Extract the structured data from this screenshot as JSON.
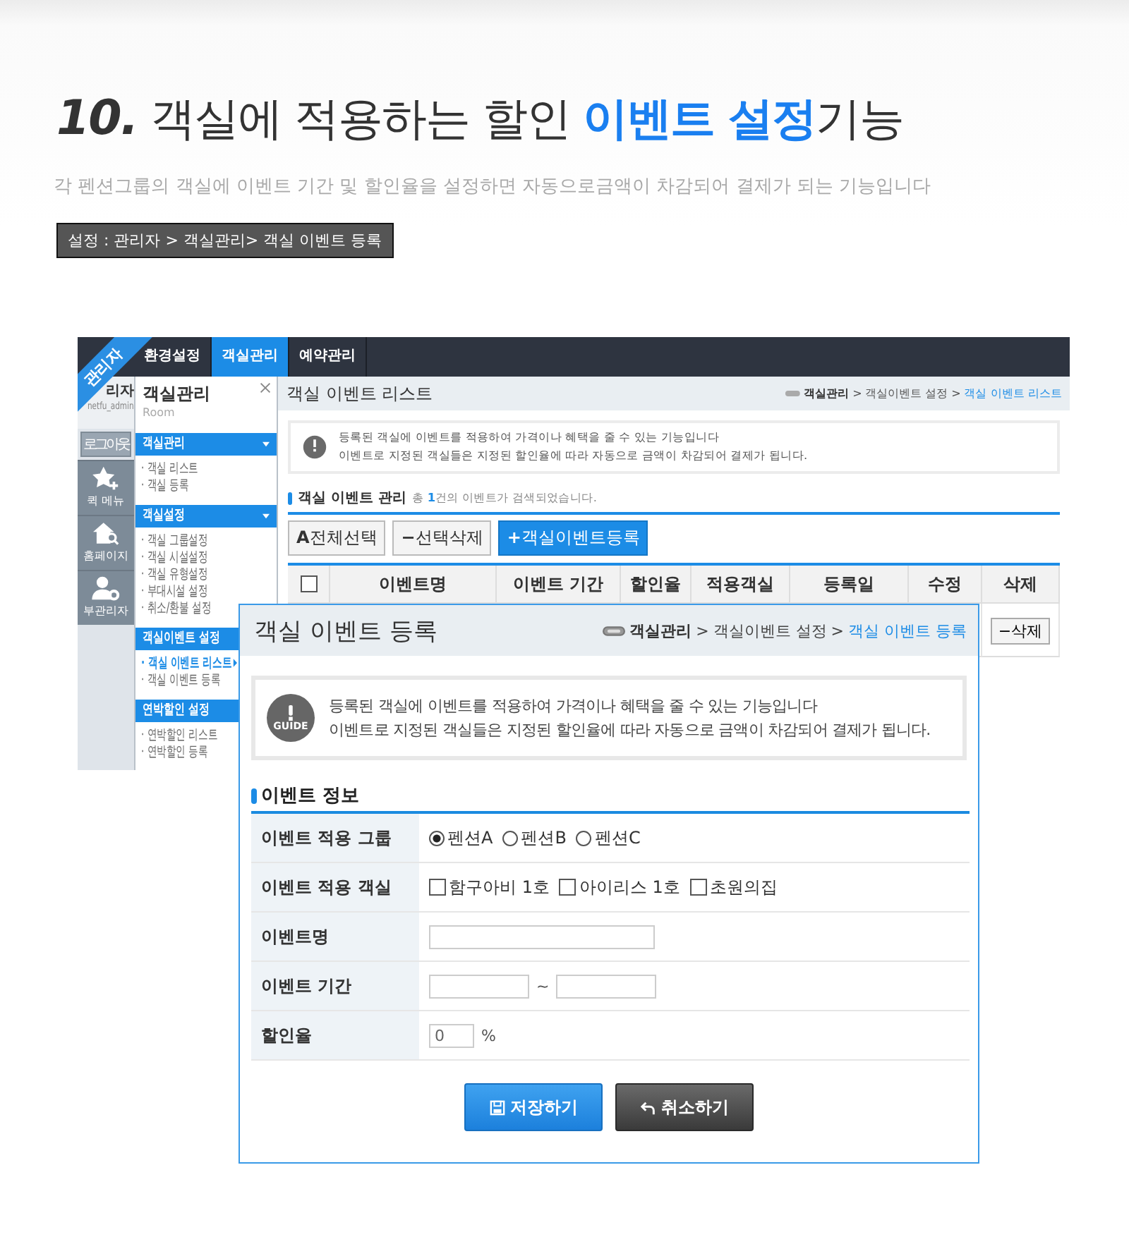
{
  "header": {
    "number": "10.",
    "text": "객실에 적용하는 할인",
    "highlight": "이벤트 설정",
    "suffix": "기능",
    "subtitle": "각 펜션그룹의 객실에 이벤트 기간 및 할인율을 설정하면 자동으로금액이 차감되어 결제가 되는 기능입니다",
    "path": "설정 : 관리자 > 객실관리> 객실 이벤트 등록"
  },
  "admin": {
    "ribbon": "관리자",
    "nav": [
      {
        "label": "환경설정",
        "selected": false
      },
      {
        "label": "객실관리",
        "selected": true
      },
      {
        "label": "예약관리",
        "selected": false
      }
    ],
    "user": {
      "name": "리자",
      "id": "netfu_admin"
    },
    "logout": "로그아웃",
    "quick": [
      {
        "kind": "star",
        "label": "퀵 메뉴"
      },
      {
        "kind": "home",
        "label": "홈페이지"
      },
      {
        "kind": "user",
        "label": "부관리자"
      }
    ],
    "sidebar": {
      "title": "객실관리",
      "subtitle": "Room",
      "groups": [
        {
          "title": "객실관리",
          "arrow": true,
          "items": [
            {
              "label": "· 객실 리스트",
              "selected": false
            },
            {
              "label": "· 객실 등록",
              "selected": false
            }
          ]
        },
        {
          "title": "객실설정",
          "arrow": true,
          "items": [
            {
              "label": "· 객실 그룹설정",
              "selected": false
            },
            {
              "label": "· 객실 시설설정",
              "selected": false
            },
            {
              "label": "· 객실 유형설정",
              "selected": false
            },
            {
              "label": "· 부대시설 설정",
              "selected": false
            },
            {
              "label": "· 취소/환불 설정",
              "selected": false
            }
          ]
        },
        {
          "title": "객실이벤트 설정",
          "items": [
            {
              "label": "· 객실 이벤트 리스트",
              "selected": true
            },
            {
              "label": "· 객실 이벤트 등록",
              "selected": false
            }
          ]
        },
        {
          "title": "연박할인 설정",
          "items": [
            {
              "label": "· 연박할인 리스트",
              "selected": false
            },
            {
              "label": "· 연박할인 등록",
              "selected": false
            }
          ]
        }
      ]
    },
    "main": {
      "title": "객실 이벤트 리스트",
      "crumbs": [
        "객실관리",
        ">",
        "객실이벤트 설정",
        ">",
        "객실 이벤트 리스트"
      ],
      "guide": [
        "등록된 객실에 이벤트를 적용하여 가격이나 혜택을 줄 수 있는 기능입니다",
        "이벤트로 지정된 객실들은 지정된 할인율에 따라 자동으로 금액이 차감되어 결제가 됩니다."
      ],
      "list_title": "객실 이벤트 관리",
      "count": {
        "prefix": "총",
        "number": "1",
        "suffix": "건의 이벤트가 검색되었습니다."
      },
      "buttons": [
        {
          "kind": "plain",
          "icon": "A",
          "label": "전체선택"
        },
        {
          "kind": "plain",
          "icon": "−",
          "label": "선택삭제"
        },
        {
          "kind": "primary",
          "icon": "+",
          "label": "객실이벤트등록"
        }
      ],
      "columns": [
        "이벤트명",
        "이벤트 기간",
        "할인율",
        "적용객실",
        "등록일",
        "수정",
        "삭제"
      ],
      "select_all": {
        "checked": false
      },
      "row_delete": {
        "icon": "−",
        "label": "삭제"
      }
    }
  },
  "dialog": {
    "title": "객실 이벤트 등록",
    "crumbs": [
      "객실관리",
      ">",
      "객실이벤트 설정",
      ">",
      "객실 이벤트 등록"
    ],
    "guide": {
      "badge": "GUIDE",
      "lines": [
        "등록된 객실에 이벤트를 적용하여 가격이나 혜택을 줄 수 있는 기능입니다",
        "이벤트로 지정된 객실들은 지정된 할인율에 따라 자동으로 금액이 차감되어 결제가 됩니다."
      ]
    },
    "section": "이벤트 정보",
    "fields": [
      {
        "kind": "radio",
        "label": "이벤트 적용 그룹",
        "options": [
          {
            "label": "펜션A",
            "selected": true
          },
          {
            "label": "펜션B",
            "selected": false
          },
          {
            "label": "펜션C",
            "selected": false
          }
        ]
      },
      {
        "kind": "checkbox",
        "label": "이벤트 적용 객실",
        "options": [
          {
            "label": "함구아비 1호",
            "checked": false
          },
          {
            "label": "아이리스 1호",
            "checked": false
          },
          {
            "label": "초원의집",
            "checked": false
          }
        ]
      },
      {
        "kind": "text",
        "label": "이벤트명"
      },
      {
        "kind": "range",
        "label": "이벤트 기간",
        "separator": "~"
      },
      {
        "kind": "number",
        "label": "할인율",
        "value": "0",
        "unit": "%"
      }
    ],
    "buttons": [
      {
        "kind": "save",
        "label": "저장하기"
      },
      {
        "kind": "cancel",
        "label": "취소하기"
      }
    ]
  }
}
